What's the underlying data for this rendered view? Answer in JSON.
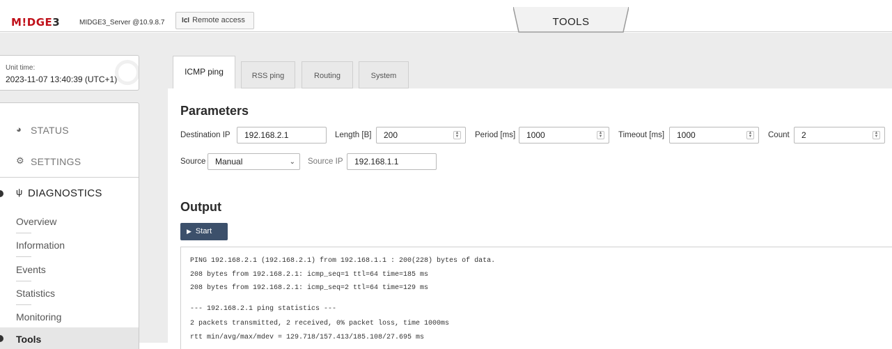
{
  "header": {
    "logo_brand": "M!DGE",
    "logo_number": "3",
    "server": "MIDGE3_Server @10.9.8.7",
    "remote_access_icon": "remote-access-icon",
    "remote_access_label": "Remote access",
    "section_tab": "TOOLS"
  },
  "sidebar": {
    "unit_time_label": "Unit time:",
    "unit_time_value": "2023-11-07 13:40:39 (UTC+1)",
    "menu": [
      {
        "label": "STATUS",
        "icon": "gauge-icon"
      },
      {
        "label": "SETTINGS",
        "icon": "gears-icon"
      },
      {
        "label": "DIAGNOSTICS",
        "icon": "stethoscope-icon"
      }
    ],
    "submenu": [
      "Overview",
      "Information",
      "Events",
      "Statistics",
      "Monitoring",
      "Tools"
    ],
    "active_submenu": "Tools"
  },
  "tabs": [
    "ICMP ping",
    "RSS ping",
    "Routing",
    "System"
  ],
  "active_tab": "ICMP ping",
  "parameters": {
    "heading": "Parameters",
    "destination_ip_label": "Destination IP",
    "destination_ip": "192.168.2.1",
    "length_label": "Length [B]",
    "length": "200",
    "period_label": "Period [ms]",
    "period": "1000",
    "timeout_label": "Timeout [ms]",
    "timeout": "1000",
    "count_label": "Count",
    "count": "2",
    "source_label": "Source",
    "source": "Manual",
    "source_ip_label": "Source IP",
    "source_ip": "192.168.1.1"
  },
  "output": {
    "heading": "Output",
    "start_label": "Start",
    "lines": [
      "PING 192.168.2.1 (192.168.2.1) from 192.168.1.1 : 200(228) bytes of data.",
      "208 bytes from 192.168.2.1: icmp_seq=1 ttl=64 time=185 ms",
      "208 bytes from 192.168.2.1: icmp_seq=2 ttl=64 time=129 ms",
      "",
      "--- 192.168.2.1 ping statistics ---",
      "2 packets transmitted, 2 received, 0% packet loss, time 1000ms",
      "rtt min/avg/max/mdev = 129.718/157.413/185.108/27.695 ms"
    ]
  },
  "colors": {
    "brand_red": "#c0111a",
    "start_button": "#3c506b",
    "band_grey": "#ececec"
  }
}
